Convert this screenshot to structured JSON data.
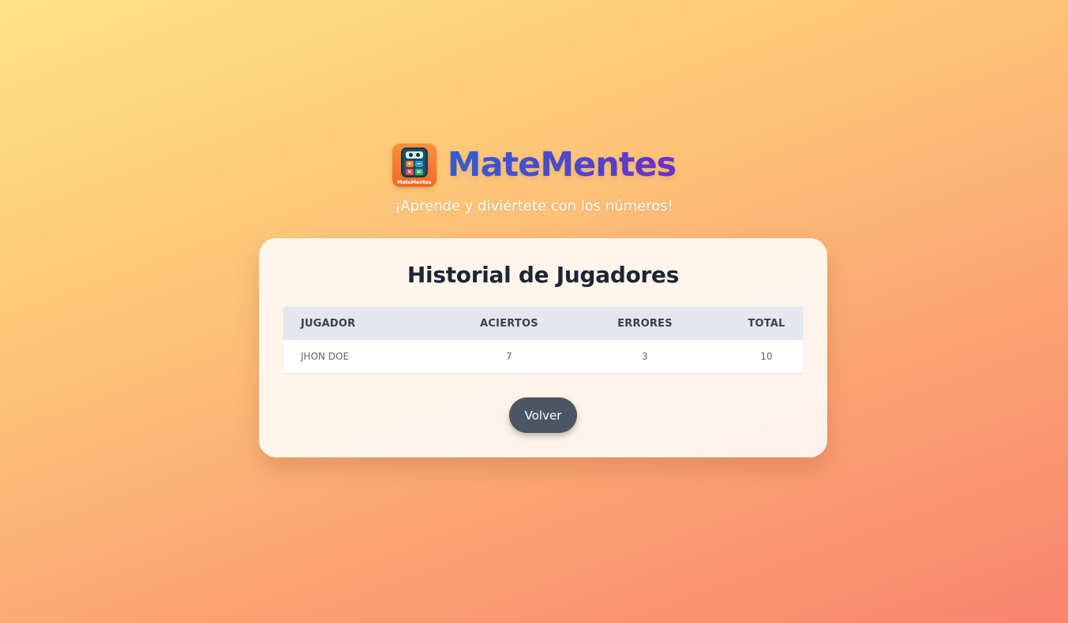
{
  "header": {
    "app_title": "MateMentes",
    "logo_label": "MateMentes",
    "tagline": "¡Aprende y diviértete con los números!"
  },
  "card": {
    "title": "Historial de Jugadores",
    "table": {
      "headers": {
        "player": "JUGADOR",
        "correct": "ACIERTOS",
        "errors": "ERRORES",
        "total": "TOTAL"
      },
      "rows": [
        {
          "player": "JHON DOE",
          "correct": "7",
          "errors": "3",
          "total": "10"
        }
      ]
    },
    "back_label": "Volver"
  },
  "colors": {
    "title_gradient_start": "#2f5fe3",
    "title_gradient_end": "#6a2fd6",
    "button_bg": "#4b5563",
    "table_header_bg": "#e4e7ec",
    "background_top": "#ffe386",
    "background_bottom": "#f98370"
  },
  "icons": {
    "logo": "calculator-mascot-icon"
  }
}
